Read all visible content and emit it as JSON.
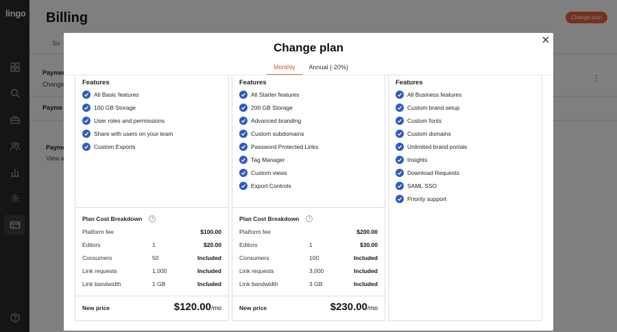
{
  "app": {
    "logo": "lingo"
  },
  "sidebar": {
    "items": [
      {
        "icon": "grid-icon"
      },
      {
        "icon": "search-icon"
      },
      {
        "icon": "briefcase-icon"
      },
      {
        "icon": "people-icon"
      },
      {
        "icon": "chart-icon"
      },
      {
        "icon": "gear-icon"
      },
      {
        "icon": "billing-card-icon",
        "active": true
      },
      {
        "icon": "help-icon"
      }
    ]
  },
  "page": {
    "title": "Billing",
    "cta_label": "Change plan",
    "bg": {
      "tab_fragment": "Su",
      "payment_heading_1": "Paymen",
      "change_fragment": "Change",
      "payment_heading_2": "Payme",
      "payment_heading_3": "Paymen",
      "view_fragment": "View a"
    }
  },
  "modal": {
    "title": "Change plan",
    "tabs": [
      {
        "label": "Monthly",
        "active": true
      },
      {
        "label": "Annual (-20%)",
        "active": false
      }
    ],
    "plans": [
      {
        "features_title": "Features",
        "features": [
          "All Basic features",
          "100 GB Storage",
          "User roles and permissions",
          "Share with users on your team",
          "Custom Exports"
        ],
        "breakdown_title": "Plan Cost Breakdown",
        "rows": [
          {
            "label": "Platform fee",
            "qty": "",
            "amount": "$100.00"
          },
          {
            "label": "Editors",
            "qty": "1",
            "amount": "$20.00"
          },
          {
            "label": "Consumers",
            "qty": "50",
            "amount": "Included"
          },
          {
            "label": "Link requests",
            "qty": "1,000",
            "amount": "Included"
          },
          {
            "label": "Link bandwidth",
            "qty": "1 GB",
            "amount": "Included"
          }
        ],
        "new_price_label": "New price",
        "new_price": "$120.00",
        "price_unit": "/mo"
      },
      {
        "features_title": "Features",
        "features": [
          "All Starter features",
          "200 GB Storage",
          "Advanced branding",
          "Custom subdomains",
          "Password Protected Links",
          "Tag Manager",
          "Custom views",
          "Export Controls"
        ],
        "breakdown_title": "Plan Cost Breakdown",
        "rows": [
          {
            "label": "Platform fee",
            "qty": "",
            "amount": "$200.00"
          },
          {
            "label": "Editors",
            "qty": "1",
            "amount": "$30.00"
          },
          {
            "label": "Consumers",
            "qty": "100",
            "amount": "Included"
          },
          {
            "label": "Link requests",
            "qty": "3,000",
            "amount": "Included"
          },
          {
            "label": "Link bandwidth",
            "qty": "3 GB",
            "amount": "Included"
          }
        ],
        "new_price_label": "New price",
        "new_price": "$230.00",
        "price_unit": "/mo"
      },
      {
        "features_title": "Features",
        "features": [
          "All Business features",
          "Custom brand setup",
          "Custom fonts",
          "Custom domains",
          "Unlimited brand portals",
          "Insights",
          "Download Requests",
          "SAML SSO",
          "Priority support"
        ]
      }
    ]
  },
  "colors": {
    "accent": "#e8623c",
    "check": "#2d5cbc",
    "sidebar": "#2b2b2b"
  }
}
